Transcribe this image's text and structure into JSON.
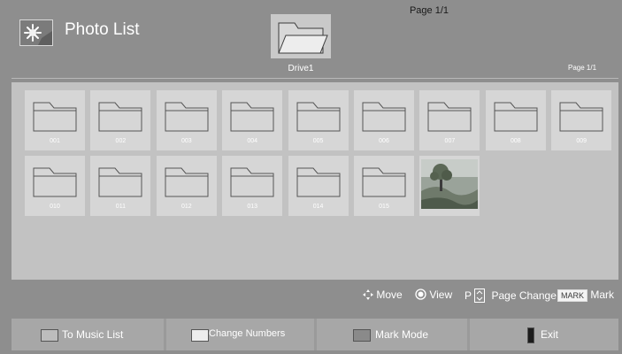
{
  "top": {
    "page_indicator": "Page 1/1"
  },
  "header": {
    "title": "Photo List",
    "drive_label": "Drive1",
    "page_indicator": "Page 1/1",
    "app_icon": "photo-icon",
    "drive_icon": "folder-open-icon"
  },
  "folders": [
    {
      "label": "001"
    },
    {
      "label": "002"
    },
    {
      "label": "003"
    },
    {
      "label": "004"
    },
    {
      "label": "005"
    },
    {
      "label": "006"
    },
    {
      "label": "007"
    },
    {
      "label": "008"
    },
    {
      "label": "009"
    },
    {
      "label": "010"
    },
    {
      "label": "011"
    },
    {
      "label": "012"
    },
    {
      "label": "013"
    },
    {
      "label": "014"
    },
    {
      "label": "015"
    }
  ],
  "photo_thumbnail": {
    "icon": "landscape-photo-thumbnail"
  },
  "controls": {
    "move": "Move",
    "view": "View",
    "page_prefix": "P",
    "page_change": "Page Change",
    "mark_badge": "MARK",
    "mark": "Mark"
  },
  "bottom": {
    "to_music_list": "To Music List",
    "change_numbers": "Change Numbers",
    "mark_mode": "Mark Mode",
    "exit": "Exit",
    "colors": {
      "red_key": "#bdbdbd",
      "green_key": "#ededed",
      "yellow_key": "#8a8a8a",
      "blue_key": "#1c1c1c"
    }
  }
}
